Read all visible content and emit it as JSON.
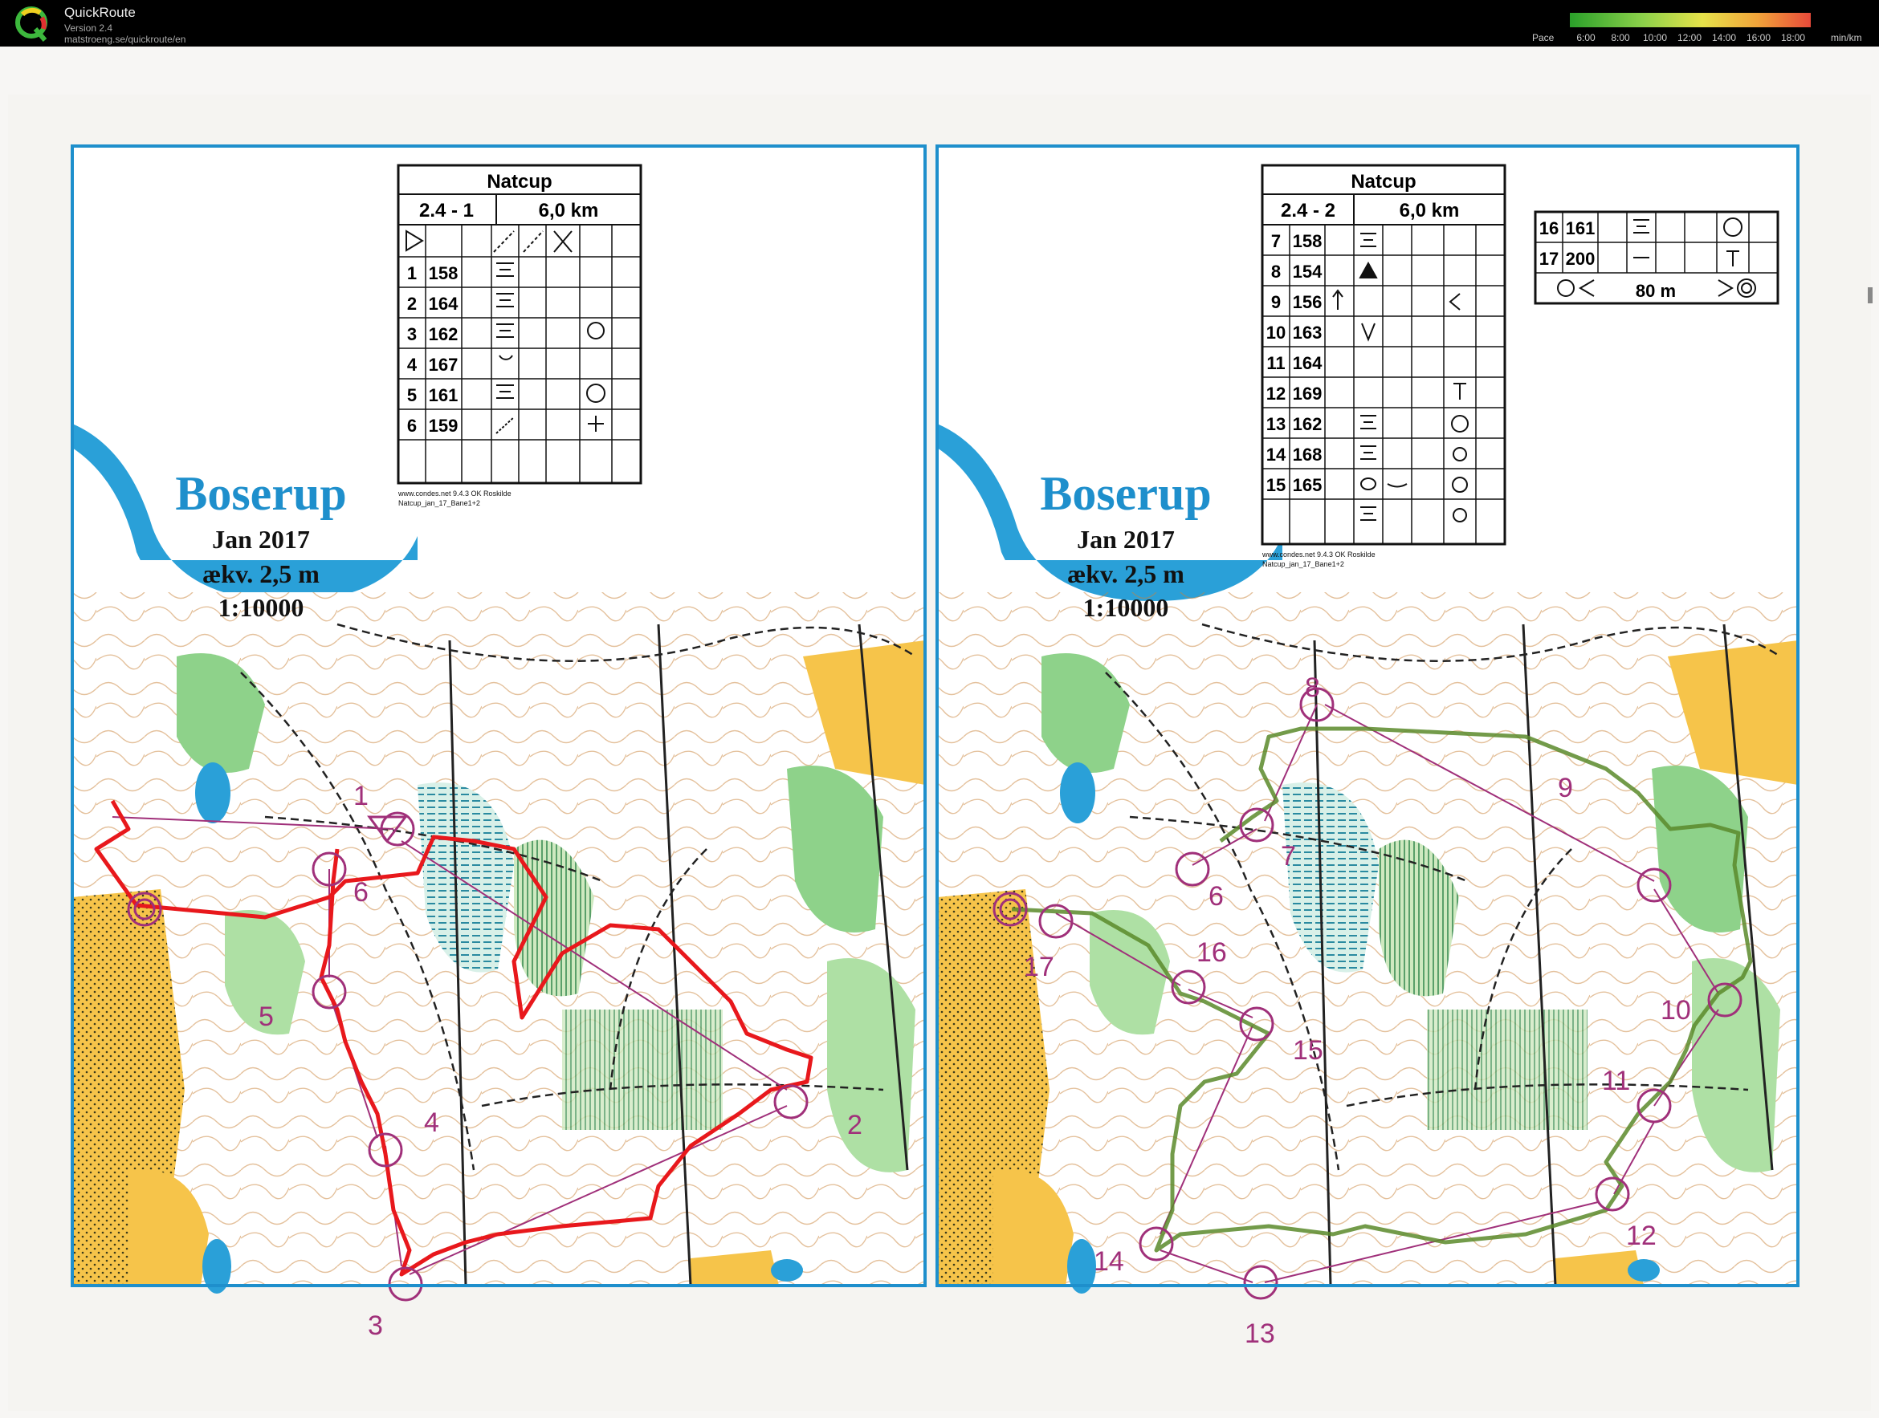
{
  "app": {
    "title": "QuickRoute",
    "version": "Version 2.4",
    "url": "matstroeng.se/quickroute/en",
    "pace_label": "Pace",
    "pace_ticks": [
      "6:00",
      "8:00",
      "10:00",
      "12:00",
      "14:00",
      "16:00",
      "18:00"
    ],
    "pace_unit": "min/km",
    "pace_colors": [
      "#2aa02a",
      "#8bd14a",
      "#e6e24a",
      "#f1a33a",
      "#e84a3a"
    ]
  },
  "left_map": {
    "name": "Boserup",
    "date": "Jan 2017",
    "contour": "ækv. 2,5 m",
    "scale": "1:10000",
    "route_color": "#e8181c",
    "control_table": {
      "title": "Natcup",
      "course": "2.4 - 1",
      "length": "6,0 km",
      "rows": [
        {
          "num": "1",
          "code": "158"
        },
        {
          "num": "2",
          "code": "164"
        },
        {
          "num": "3",
          "code": "162"
        },
        {
          "num": "4",
          "code": "167"
        },
        {
          "num": "5",
          "code": "161"
        },
        {
          "num": "6",
          "code": "159"
        }
      ],
      "footer1": "www.condes.net 9.4.3 OK Roskilde",
      "footer2": "Natcup_jan_17_Bane1+2"
    },
    "control_labels": [
      "1",
      "2",
      "3",
      "4",
      "5",
      "6"
    ]
  },
  "right_map": {
    "name": "Boserup",
    "date": "Jan 2017",
    "contour": "ækv. 2,5 m",
    "scale": "1:10000",
    "route_color": "#5a8a2a",
    "control_table": {
      "title": "Natcup",
      "course": "2.4 - 2",
      "length": "6,0 km",
      "rows": [
        {
          "num": "7",
          "code": "158"
        },
        {
          "num": "8",
          "code": "154"
        },
        {
          "num": "9",
          "code": "156"
        },
        {
          "num": "10",
          "code": "163"
        },
        {
          "num": "11",
          "code": "164"
        },
        {
          "num": "12",
          "code": "169"
        },
        {
          "num": "13",
          "code": "162"
        },
        {
          "num": "14",
          "code": "168"
        },
        {
          "num": "15",
          "code": "165"
        }
      ],
      "footer1": "www.condes.net 9.4.3 OK Roskilde",
      "footer2": "Natcup_jan_17_Bane1+2"
    },
    "extra_table": {
      "rows": [
        {
          "num": "16",
          "code": "161"
        },
        {
          "num": "17",
          "code": "200"
        }
      ],
      "finish_distance": "80 m"
    },
    "control_labels": [
      "6",
      "7",
      "8",
      "9",
      "10",
      "11",
      "12",
      "13",
      "14",
      "15",
      "16",
      "17"
    ]
  }
}
